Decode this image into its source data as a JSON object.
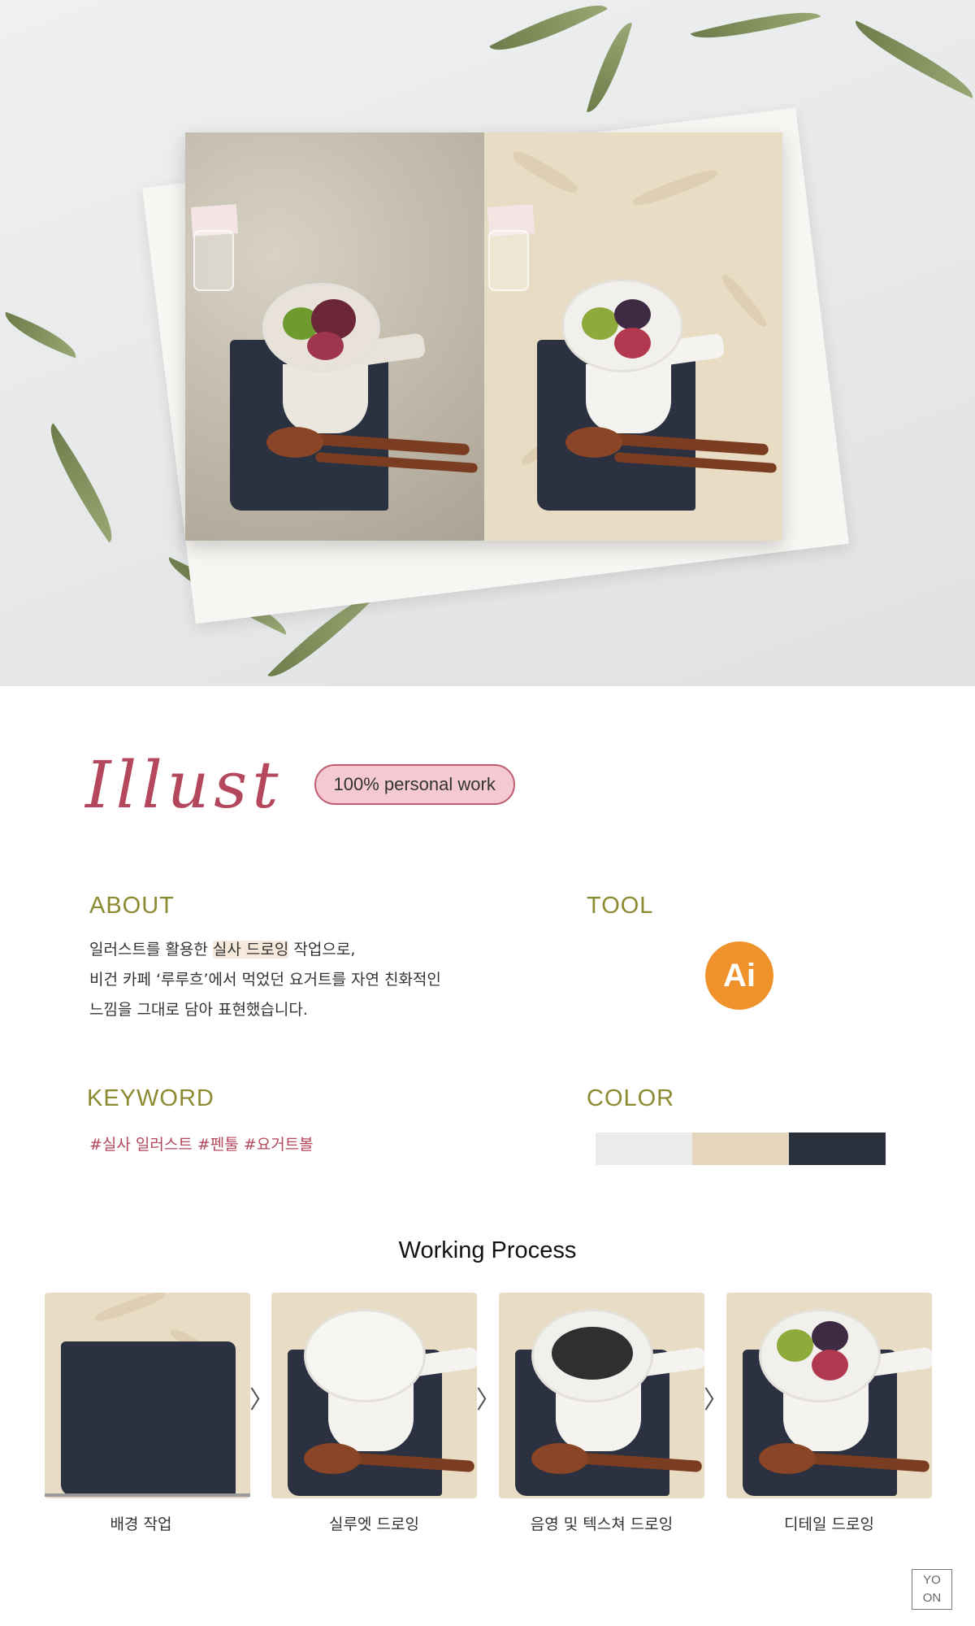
{
  "title": "Illust",
  "badge": "100% personal work",
  "about": {
    "heading": "ABOUT",
    "line1_pre": "일러스트를 활용한 ",
    "line1_hl": "실사 드로잉",
    "line1_post": " 작업으로,",
    "line2": "비건 카페 ‘루루흐’에서 먹었던 요거트를 자연 친화적인",
    "line3": "느낌을 그대로 담아 표현했습니다."
  },
  "tool": {
    "heading": "TOOL",
    "icon_label": "Ai",
    "icon_color": "#f0922b"
  },
  "keyword": {
    "heading": "KEYWORD",
    "text": "#실사 일러스트 #펜툴 #요거트볼"
  },
  "color": {
    "heading": "COLOR",
    "swatches": [
      "#ebebeb",
      "#e6d5bd",
      "#2b313c"
    ]
  },
  "process": {
    "title": "Working Process",
    "steps": [
      {
        "label": "배경 작업"
      },
      {
        "label": "실루엣 드로잉"
      },
      {
        "label": "음영 및 텍스쳐 드로잉"
      },
      {
        "label": "디테일 드로잉"
      }
    ],
    "arrow": "〉"
  },
  "logo": {
    "line1": "YO",
    "line2": "ON"
  },
  "colors": {
    "accent": "#b4475c",
    "olive": "#8c8a30"
  }
}
